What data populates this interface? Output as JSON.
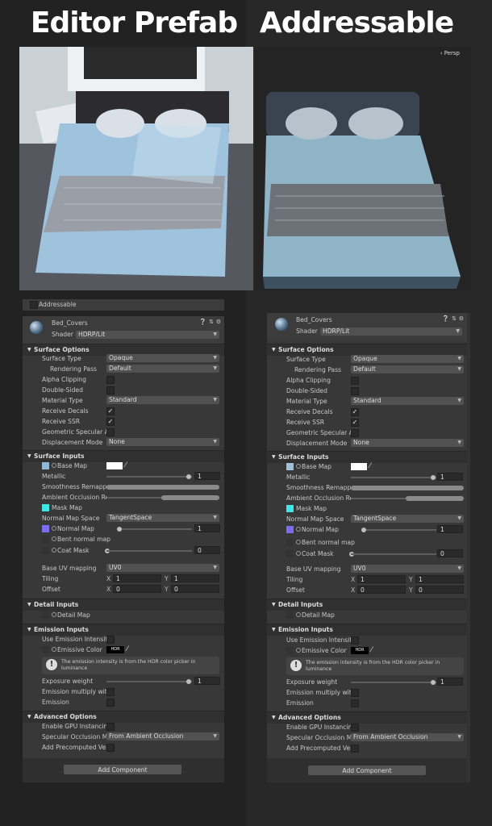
{
  "headings": {
    "left": "Editor Prefab",
    "right": "Addressable"
  },
  "viewport_right": {
    "persp_label": "‹ Persp"
  },
  "addressable_label": "Addressable",
  "material": {
    "name": "Bed_Covers",
    "shader_label": "Shader",
    "shader_value": "HDRP/Lit"
  },
  "sections": {
    "surface_options": "Surface Options",
    "surface_inputs": "Surface Inputs",
    "detail_inputs": "Detail Inputs",
    "emission_inputs": "Emission Inputs",
    "advanced_options": "Advanced Options"
  },
  "surface_options": {
    "surface_type": "Surface Type",
    "surface_type_value": "Opaque",
    "rendering_pass": "Rendering Pass",
    "rendering_pass_value": "Default",
    "alpha_clipping": "Alpha Clipping",
    "double_sided": "Double-Sided",
    "material_type": "Material Type",
    "material_type_value": "Standard",
    "receive_decals": "Receive Decals",
    "receive_ssr": "Receive SSR",
    "geometric_specular": "Geometric Specular A",
    "displacement_mode": "Displacement Mode",
    "displacement_mode_value": "None"
  },
  "surface_inputs": {
    "base_map": "Base Map",
    "metallic": "Metallic",
    "metallic_value": "1",
    "smoothness_remap": "Smoothness Remappi",
    "ao_remap": "Ambient Occlusion Re",
    "mask_map": "Mask Map",
    "normal_map_space": "Normal Map Space",
    "normal_map_space_value": "TangentSpace",
    "normal_map": "Normal Map",
    "normal_map_value": "1",
    "bent_normal_map": "Bent normal map",
    "coat_mask": "Coat Mask",
    "coat_mask_value": "0",
    "base_uv_mapping": "Base UV mapping",
    "base_uv_mapping_value": "UV0",
    "tiling": "Tiling",
    "tiling_x": "1",
    "tiling_y": "1",
    "offset": "Offset",
    "offset_x": "0",
    "offset_y": "0",
    "x": "X",
    "y": "Y"
  },
  "detail_inputs": {
    "detail_map": "Detail Map"
  },
  "emission_inputs": {
    "use_emission_intensity": "Use Emission Intensity",
    "emissive_color": "Emissive Color",
    "hdr": "HDR",
    "help_text": "The emission intensity is from the HDR color picker in luminance",
    "exposure_weight": "Exposure weight",
    "exposure_weight_value": "1",
    "emission_multiply": "Emission multiply with",
    "emission": "Emission"
  },
  "advanced_options": {
    "gpu_instancing": "Enable GPU Instancing",
    "specular_occlusion": "Specular Occlusion M",
    "specular_occlusion_value": "From Ambient Occlusion",
    "precomputed_velocity": "Add Precomputed Velo"
  },
  "add_component": "Add Component",
  "colors": {
    "bg": "#262626",
    "panel": "#383838",
    "header": "#303030",
    "mask_swatch": "#3fe6e6",
    "normal_swatch": "#7d6cf0",
    "base_swatch_left": "#8fb8d6",
    "base_swatch_right": "#9fc0d8"
  }
}
